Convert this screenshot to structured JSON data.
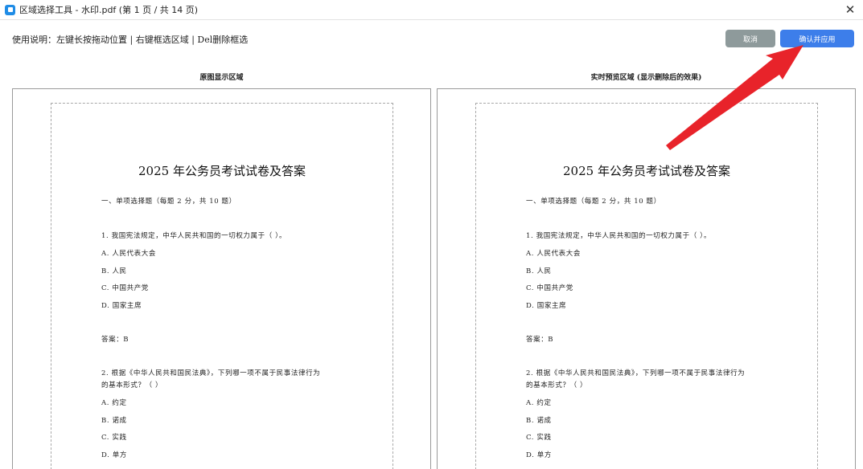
{
  "window": {
    "title": "区域选择工具 - 水印.pdf (第 1 页 / 共 14 页)",
    "close_glyph": "✕"
  },
  "toolbar": {
    "instructions": "使用说明：左键长按拖动位置 | 右键框选区域 | Del删除框选",
    "cancel_label": "取消",
    "confirm_label": "确认并应用"
  },
  "panels": {
    "original_title": "原图显示区域",
    "preview_title": "实时预览区域 (显示删除后的效果)"
  },
  "document": {
    "title": "2025 年公务员考试试卷及答案",
    "lines": [
      "一、单项选择题（每题 2 分，共 10 题）",
      "1. 我国宪法规定，中华人民共和国的一切权力属于（ ）。",
      "A. 人民代表大会",
      "B. 人民",
      "C. 中国共产党",
      "D. 国家主席",
      "答案：B",
      "2. 根据《中华人民共和国民法典》，下列哪一项不属于民事法律行为",
      "的基本形式？（ ）",
      "A. 约定",
      "B. 诺成",
      "C. 实践",
      "D. 单方"
    ]
  },
  "annotation": {
    "arrow_color": "#e8232a"
  }
}
